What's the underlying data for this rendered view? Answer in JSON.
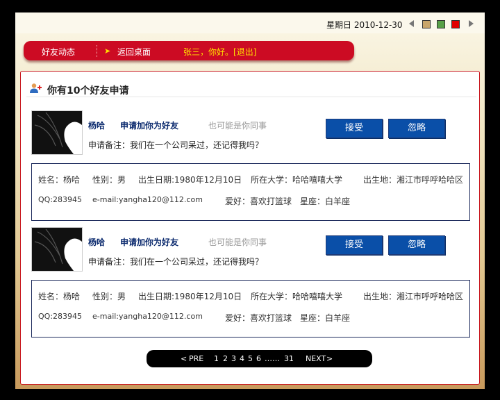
{
  "topbar": {
    "date_text": "星期日  2010-12-30",
    "swatches": [
      "#c9a66b",
      "#57a048",
      "#e00000"
    ]
  },
  "menu": {
    "friends_feed": "好友动态",
    "back_desktop": "返回桌面",
    "greeting": "张三，你好。",
    "logout": "[退出]"
  },
  "panel": {
    "title": "你有10个好友申请"
  },
  "requests": [
    {
      "name": "杨哈",
      "action": "申请加你为好友",
      "hint": "也可能是你同事",
      "note": "申请备注：我们在一个公司呆过，还记得我吗？",
      "accept": "接受",
      "ignore": "忽略",
      "info": {
        "name": "姓名：杨哈",
        "gender": "性别：男",
        "birthday": "出生日期:1980年12月10日",
        "university": "所在大学：哈哈嘻嘻大学",
        "birthplace": "出生地：湘江市呼呼哈哈区",
        "qq": "QQ:283945",
        "email": "e-mail:yangha120@112.com",
        "hobby": "爱好：喜欢打篮球",
        "zodiac": "星座：白羊座"
      }
    },
    {
      "name": "杨哈",
      "action": "申请加你为好友",
      "hint": "也可能是你同事",
      "note": "申请备注：我们在一个公司呆过，还记得我吗？",
      "accept": "接受",
      "ignore": "忽略",
      "info": {
        "name": "姓名：杨哈",
        "gender": "性别：男",
        "birthday": "出生日期:1980年12月10日",
        "university": "所在大学：哈哈嘻嘻大学",
        "birthplace": "出生地：湘江市呼呼哈哈区",
        "qq": "QQ:283945",
        "email": "e-mail:yangha120@112.com",
        "hobby": "爱好：喜欢打篮球",
        "zodiac": "星座：白羊座"
      }
    }
  ],
  "pager": {
    "prev": "PRE",
    "pages": [
      "1",
      "2",
      "3",
      "4",
      "5",
      "6"
    ],
    "ellipsis": "……",
    "last": "31",
    "next": "NEXT"
  }
}
